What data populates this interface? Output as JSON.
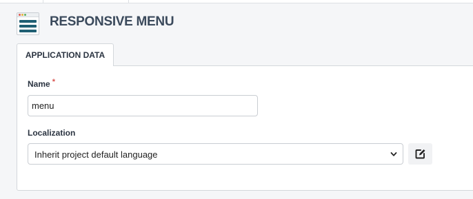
{
  "header": {
    "title": "RESPONSIVE MENU",
    "app_icon": "hamburger-menu-icon"
  },
  "tabs": [
    {
      "label": "APPLICATION DATA",
      "active": true
    }
  ],
  "form": {
    "name": {
      "label": "Name",
      "required_marker": "*",
      "value": "menu"
    },
    "localization": {
      "label": "Localization",
      "selected": "Inherit project default language",
      "edit_icon": "edit-icon"
    }
  },
  "colors": {
    "title": "#3b4a5c",
    "icon_bars": "#1f5f73",
    "required": "#d9534f",
    "border": "#d3d7db"
  }
}
